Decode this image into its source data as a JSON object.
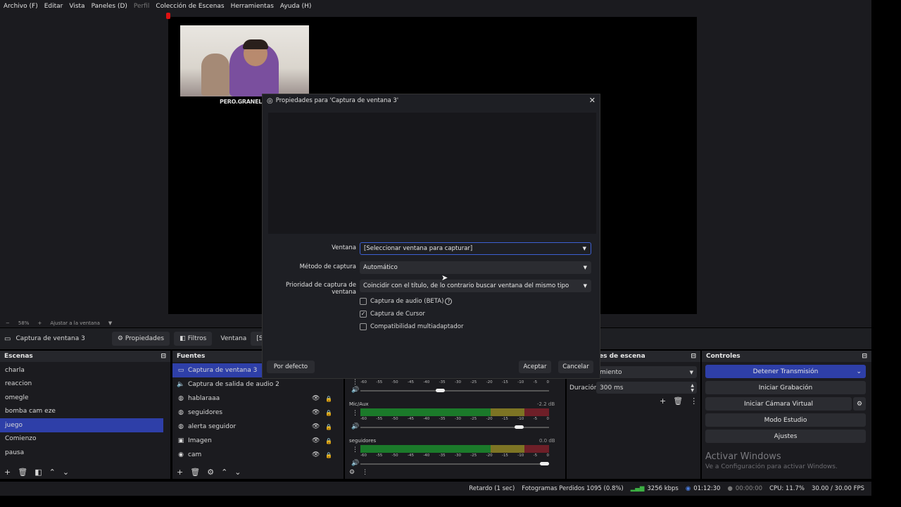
{
  "menubar": {
    "items": [
      "Archivo (F)",
      "Editar",
      "Vista",
      "Paneles (D)",
      "Perfil",
      "Colección de Escenas",
      "Herramientas",
      "Ayuda (H)"
    ]
  },
  "preview": {
    "watermark_text": "PERO.GRANEL",
    "zoom": "58%",
    "fit_label": "Ajustar a la ventana"
  },
  "source_toolbar": {
    "source_name": "Captura de ventana 3",
    "properties_label": "Propiedades",
    "filters_label": "Filtros",
    "window_label": "Ventana",
    "window_value": "[Seleccionar"
  },
  "scenes": {
    "title": "Escenas",
    "items": [
      "charla",
      "reaccion",
      "omegle",
      "bomba cam eze",
      "juego",
      "Comienzo",
      "pausa"
    ],
    "selected_index": 4
  },
  "sources": {
    "title": "Fuentes",
    "items": [
      {
        "label": "Captura de ventana 3",
        "icon": "window-capture-icon"
      },
      {
        "label": "Captura de salida de audio 2",
        "icon": "speaker-icon"
      },
      {
        "label": "hablaraaa",
        "icon": "browser-icon"
      },
      {
        "label": "seguidores",
        "icon": "browser-icon"
      },
      {
        "label": "alerta seguidor",
        "icon": "browser-icon"
      },
      {
        "label": "Imagen",
        "icon": "image-icon"
      },
      {
        "label": "cam",
        "icon": "camera-icon"
      }
    ]
  },
  "mixer": {
    "ticks": [
      "-60",
      "-55",
      "-50",
      "-45",
      "-40",
      "-35",
      "-30",
      "-25",
      "-20",
      "-15",
      "-10",
      "-5",
      "0"
    ],
    "channels": [
      {
        "name": "Mic/Aux",
        "db": "-2.2 dB",
        "level": 0.56,
        "volume": 0.86
      },
      {
        "name": "seguidores",
        "db": "0.0 dB",
        "level": 0.0,
        "volume": 1.0
      }
    ],
    "top_volume": 0.42
  },
  "transitions": {
    "title": "es de escena",
    "transition_value": "miento",
    "duration_label": "Duración",
    "duration_value": "300 ms"
  },
  "controls": {
    "title": "Controles",
    "stop_stream": "Detener Transmisión",
    "start_recording": "Iniciar Grabación",
    "virtual_cam": "Iniciar Cámara Virtual",
    "studio_mode": "Modo Estudio",
    "settings": "Ajustes"
  },
  "windows_watermark": {
    "line1": "Activar Windows",
    "line2": "Ve a Configuración para activar Windows."
  },
  "statusbar": {
    "delay": "Retardo (1 sec)",
    "dropped": "Fotogramas Perdidos 1095 (0.8%)",
    "bitrate": "3256 kbps",
    "stream_time": "01:12:30",
    "rec_time": "00:00:00",
    "cpu": "CPU: 11.7%",
    "fps": "30.00 / 30.00 FPS"
  },
  "dialog": {
    "title": "Propiedades para 'Captura de ventana 3'",
    "window_label": "Ventana",
    "window_value": "[Seleccionar ventana para capturar]",
    "method_label": "Método de captura",
    "method_value": "Automático",
    "priority_label": "Prioridad de captura de ventana",
    "priority_value": "Coincidir con el título, de lo contrario buscar ventana del mismo tipo",
    "audio_capture": "Captura de audio (BETA)",
    "cursor_capture": "Captura de Cursor",
    "multiadapter": "Compatibilidad multiadaptador",
    "defaults": "Por defecto",
    "accept": "Aceptar",
    "cancel": "Cancelar"
  }
}
